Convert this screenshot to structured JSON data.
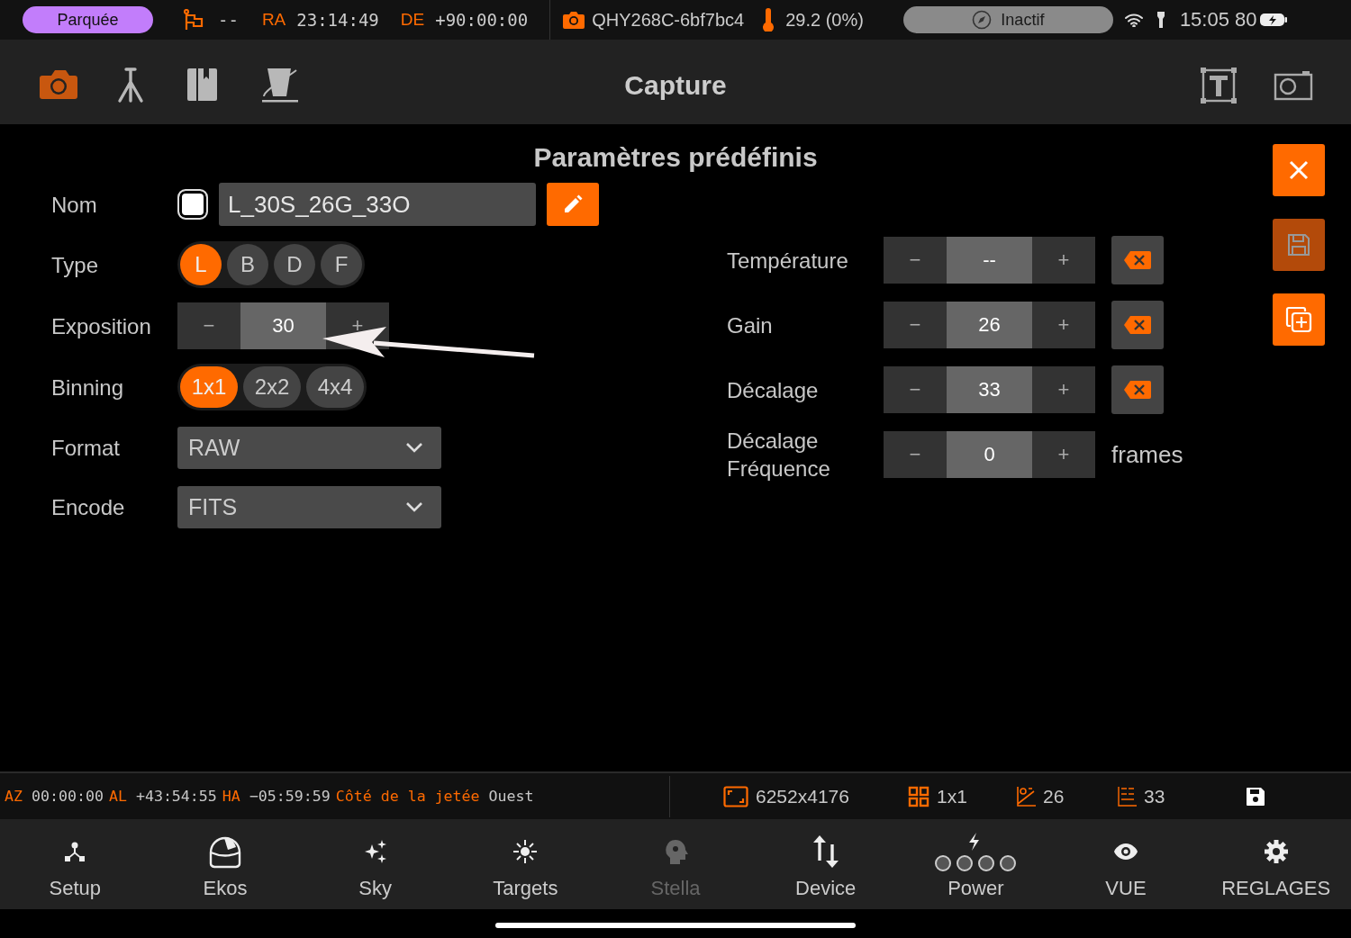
{
  "status_bar": {
    "mount_status": "Parquée",
    "pier": "--",
    "ra_label": "RA",
    "ra": "23:14:49",
    "de_label": "DE",
    "de": "+90:00:00",
    "camera": "QHY268C-6bf7bc4",
    "temperature": "29.2 (0%)",
    "activity": "Inactif",
    "time": "15:05",
    "battery": "80"
  },
  "toolbar": {
    "title": "Capture",
    "tools": [
      {
        "kind": "camera",
        "selected": true
      },
      {
        "kind": "mount",
        "selected": false
      },
      {
        "kind": "notebook",
        "selected": false
      },
      {
        "kind": "filter",
        "selected": false
      }
    ]
  },
  "dialog": {
    "title": "Paramètres prédéfinis",
    "name": {
      "label": "Nom",
      "checked": false,
      "value": "L_30S_26G_33O"
    },
    "type": {
      "label": "Type",
      "options": [
        {
          "label": "L",
          "selected": true
        },
        {
          "label": "B",
          "selected": false
        },
        {
          "label": "D",
          "selected": false
        },
        {
          "label": "F",
          "selected": false
        }
      ]
    },
    "exposure": {
      "label": "Exposition",
      "minus": "−",
      "value": "30",
      "plus": "+"
    },
    "binning": {
      "label": "Binning",
      "options": [
        {
          "label": "1x1",
          "selected": true
        },
        {
          "label": "2x2",
          "selected": false
        },
        {
          "label": "4x4",
          "selected": false
        }
      ]
    },
    "format": {
      "label": "Format",
      "value": "RAW"
    },
    "encode": {
      "label": "Encode",
      "value": "FITS"
    },
    "settings": [
      {
        "label": "Température",
        "minus": "−",
        "value": "--",
        "plus": "+",
        "clearable": true
      },
      {
        "label": "Gain",
        "minus": "−",
        "value": "26",
        "plus": "+",
        "clearable": true
      },
      {
        "label": "Décalage",
        "minus": "−",
        "value": "33",
        "plus": "+",
        "clearable": true
      },
      {
        "label": "Décalage Fréquence",
        "minus": "−",
        "value": "0",
        "plus": "+",
        "clearable": false,
        "unit": "frames"
      }
    ],
    "actions": [
      {
        "kind": "close",
        "disabled": false
      },
      {
        "kind": "save",
        "disabled": true
      },
      {
        "kind": "duplicate",
        "disabled": false
      }
    ]
  },
  "info_bar": {
    "coordinates": [
      {
        "label": "AZ",
        "value": "00:00:00"
      },
      {
        "label": "AL",
        "value": "+43:54:55"
      },
      {
        "label": "HA",
        "value": "−05:59:59"
      },
      {
        "label": "Côté de la jetée",
        "value": "Ouest"
      }
    ],
    "stats": [
      {
        "kind": "resolution",
        "value": "6252x4176"
      },
      {
        "kind": "binning",
        "value": "1x1"
      },
      {
        "kind": "gain",
        "value": "26"
      },
      {
        "kind": "offset",
        "value": "33"
      }
    ]
  },
  "nav": [
    {
      "kind": "setup",
      "label": "Setup",
      "disabled": false
    },
    {
      "kind": "ekos",
      "label": "Ekos",
      "disabled": false
    },
    {
      "kind": "sky",
      "label": "Sky",
      "disabled": false
    },
    {
      "kind": "targets",
      "label": "Targets",
      "disabled": false
    },
    {
      "kind": "stella",
      "label": "Stella",
      "disabled": true
    },
    {
      "kind": "device",
      "label": "Device",
      "disabled": false
    },
    {
      "kind": "power",
      "label": "Power",
      "disabled": false
    },
    {
      "kind": "view",
      "label": "VUE",
      "disabled": false
    },
    {
      "kind": "settings",
      "label": "REGLAGES",
      "disabled": false
    }
  ]
}
